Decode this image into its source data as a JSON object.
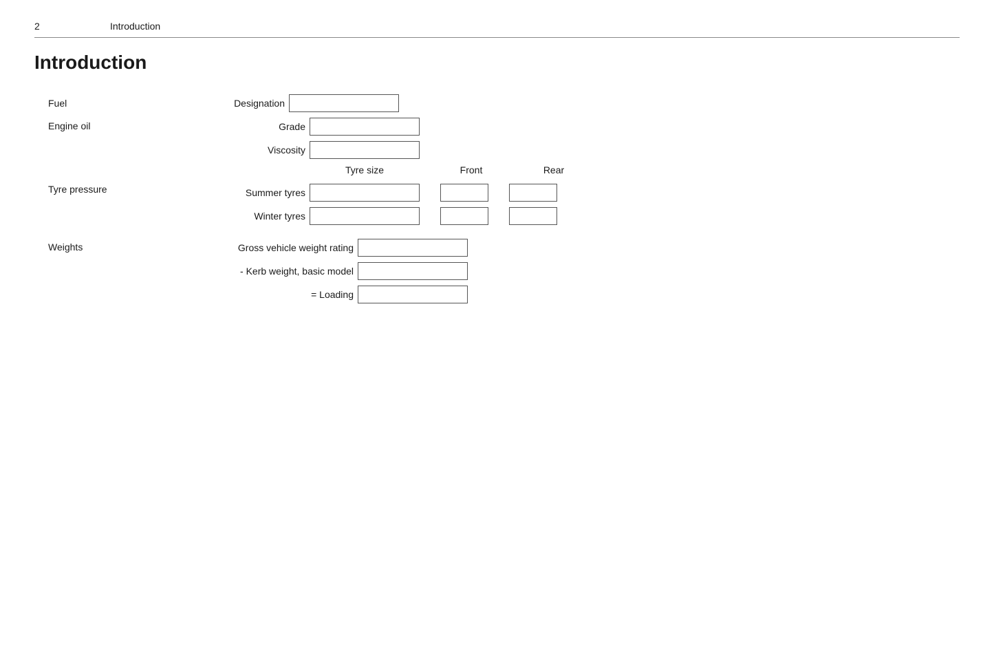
{
  "header": {
    "page_number": "2",
    "title": "Introduction"
  },
  "page_title": "Introduction",
  "fuel": {
    "section_label": "Fuel",
    "designation_label": "Designation"
  },
  "engine_oil": {
    "section_label": "Engine oil",
    "grade_label": "Grade",
    "viscosity_label": "Viscosity"
  },
  "tyre_pressure": {
    "section_label": "Tyre pressure",
    "tyre_size_header": "Tyre size",
    "front_header": "Front",
    "rear_header": "Rear",
    "summer_tyres_label": "Summer tyres",
    "winter_tyres_label": "Winter tyres"
  },
  "weights": {
    "section_label": "Weights",
    "gross_vehicle_weight_label": "Gross vehicle weight rating",
    "kerb_weight_label": "- Kerb weight, basic model",
    "loading_label": "= Loading"
  }
}
